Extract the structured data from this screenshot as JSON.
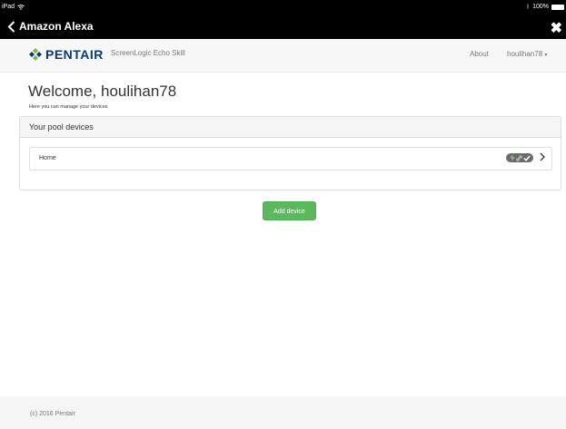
{
  "statusbar": {
    "device": "iPad",
    "battery": "100%"
  },
  "navbar": {
    "back_label": "Amazon Alexa"
  },
  "header": {
    "logo_text": "PENTAIR",
    "brand": "ScreenLogic Echo Skill",
    "about": "About",
    "user": "houlihan78"
  },
  "main": {
    "title": "Welcome, houlihan78",
    "subtitle": "Here you can manage your devices",
    "panel_title": "Your pool devices",
    "devices": [
      {
        "name": "Home",
        "status_icons": [
          "bolt-icon",
          "link-icon",
          "check-icon"
        ]
      }
    ],
    "add_button": "Add device"
  },
  "footer": {
    "copyright": "(c) 2016 Pentair"
  },
  "colors": {
    "logo_blue": "#0b3a72",
    "logo_green": "#7ab648",
    "add_button": "#5cb85c",
    "status_badge": "#6b6b6b"
  }
}
